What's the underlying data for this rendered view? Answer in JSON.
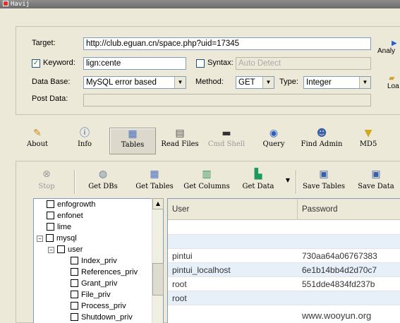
{
  "window": {
    "title": "Havij"
  },
  "form": {
    "target_label": "Target:",
    "target_value": "http://club.eguan.cn/space.php?uid=17345",
    "keyword_label": "Keyword:",
    "keyword_checked": "✓",
    "keyword_value": "lign:cente",
    "syntax_label": "Syntax:",
    "syntax_placeholder": "Auto Detect",
    "database_label": "Data Base:",
    "database_value": "MySQL error based",
    "method_label": "Method:",
    "method_value": "GET",
    "type_label": "Type:",
    "type_value": "Integer",
    "postdata_label": "Post Data:",
    "postdata_value": ""
  },
  "side_buttons": {
    "analyze": "Analy",
    "load": "Loa"
  },
  "main_toolbar": [
    {
      "label": "About",
      "icon": "about-icon"
    },
    {
      "label": "Info",
      "icon": "info-icon"
    },
    {
      "label": "Tables",
      "icon": "tables-icon"
    },
    {
      "label": "Read Files",
      "icon": "file-icon"
    },
    {
      "label": "Cmd Shell",
      "icon": "terminal-icon"
    },
    {
      "label": "Query",
      "icon": "query-icon"
    },
    {
      "label": "Find Admin",
      "icon": "admin-icon"
    },
    {
      "label": "MD5",
      "icon": "funnel-icon"
    }
  ],
  "tables_toolbar": [
    {
      "label": "Stop",
      "icon": "stop-icon"
    },
    {
      "label": "Get DBs",
      "icon": "database-icon"
    },
    {
      "label": "Get Tables",
      "icon": "table-icon"
    },
    {
      "label": "Get Columns",
      "icon": "columns-icon"
    },
    {
      "label": "Get Data",
      "icon": "data-icon"
    },
    {
      "label": "Save Tables",
      "icon": "save-icon"
    },
    {
      "label": "Save Data",
      "icon": "save-icon"
    }
  ],
  "tree": [
    "enfogrowth",
    "enfonet",
    "lime",
    "mysql",
    "user",
    "Index_priv",
    "References_priv",
    "Grant_priv",
    "File_priv",
    "Process_priv",
    "Shutdown_priv"
  ],
  "grid": {
    "columns": [
      "User",
      "Password"
    ],
    "rows": [
      {
        "user": "",
        "password": ""
      },
      {
        "user": "",
        "password": ""
      },
      {
        "user": "pintui",
        "password": "730aa64a06767383"
      },
      {
        "user": "pintui_localhost",
        "password": "6e1b14bb4d2d70c7"
      },
      {
        "user": "root",
        "password": "551dde4834fd237b"
      },
      {
        "user": "root",
        "password": ""
      }
    ]
  },
  "watermark": "www.wooyun.org"
}
